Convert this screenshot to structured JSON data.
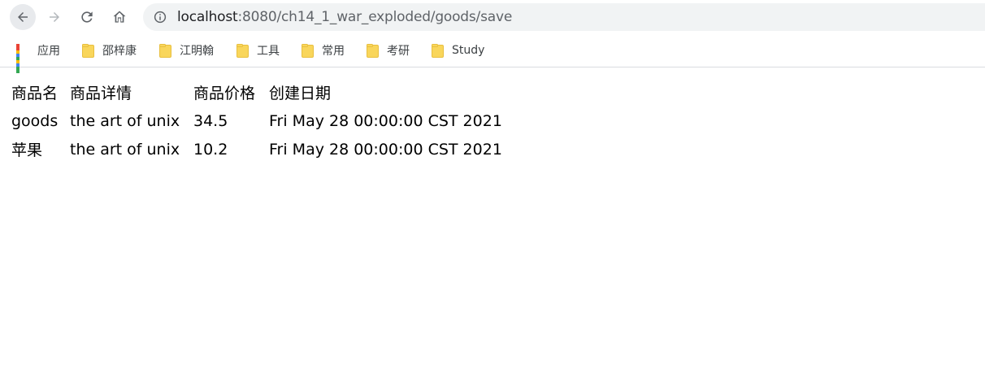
{
  "browser": {
    "url_host": "localhost",
    "url_rest": ":8080/ch14_1_war_exploded/goods/save"
  },
  "bookmarks": [
    {
      "label": "应用",
      "icon": "apps-grid-icon"
    },
    {
      "label": "邵梓康",
      "icon": "folder-icon"
    },
    {
      "label": "江明翰",
      "icon": "folder-icon"
    },
    {
      "label": "工具",
      "icon": "folder-icon"
    },
    {
      "label": "常用",
      "icon": "folder-icon"
    },
    {
      "label": "考研",
      "icon": "folder-icon"
    },
    {
      "label": "Study",
      "icon": "folder-icon"
    }
  ],
  "table": {
    "headers": [
      "商品名",
      "商品详情",
      "商品价格",
      "创建日期"
    ],
    "rows": [
      [
        "goods",
        "the art of unix",
        "34.5",
        "Fri May 28 00:00:00 CST 2021"
      ],
      [
        "苹果",
        "the art of unix",
        "10.2",
        "Fri May 28 00:00:00 CST 2021"
      ]
    ]
  },
  "colors": {
    "folder": "#f9d65b",
    "omnibox_bg": "#f1f3f4",
    "apps": [
      "#ea4335",
      "#fbbc04",
      "#34a853",
      "#4285f4"
    ]
  }
}
